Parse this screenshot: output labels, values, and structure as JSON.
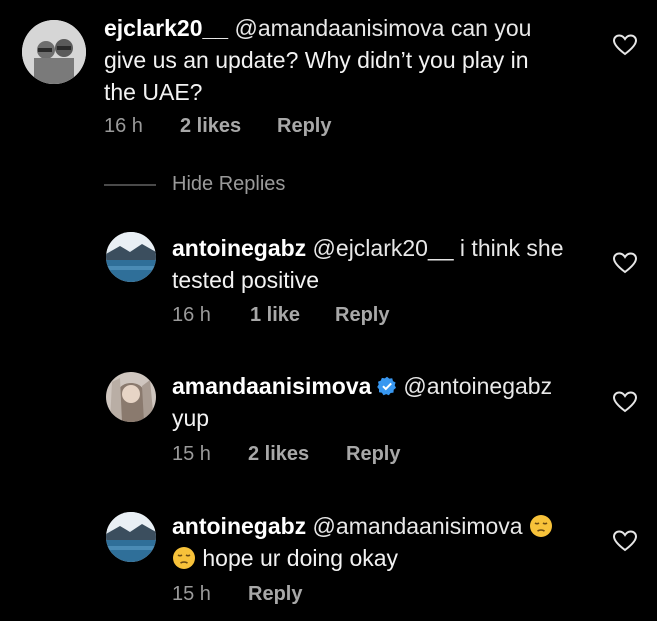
{
  "comments": [
    {
      "username": "ejclark20__",
      "text_line1_rest": " @amandaanisimova can you",
      "text_line2": "give us an update?  Why didn’t you play in",
      "text_line3": "the UAE?",
      "time": "16 h",
      "likes": "2 likes",
      "reply": "Reply"
    },
    {
      "username": "antoinegabz",
      "text_line1_rest": " @ejclark20__ i think she",
      "text_line2": "tested positive",
      "time": "16 h",
      "likes": "1 like",
      "reply": "Reply"
    },
    {
      "username": "amandaanisimova",
      "text_line1_rest": "@antoinegabz",
      "text_line2": "yup",
      "time": "15 h",
      "likes": "2 likes",
      "reply": "Reply"
    },
    {
      "username": "antoinegabz",
      "text_line1_rest": " @amandaanisimova ",
      "text_line2": " hope ur doing okay",
      "time": "15 h",
      "reply": "Reply"
    }
  ],
  "hide_replies": "Hide Replies",
  "icons": {
    "heart": "heart-outline-icon",
    "verified": "verified-badge-icon",
    "emoji": "pensive-face-emoji"
  },
  "colors": {
    "background": "#000000",
    "verified": "#3897f0",
    "emoji": "#f7c23a"
  }
}
